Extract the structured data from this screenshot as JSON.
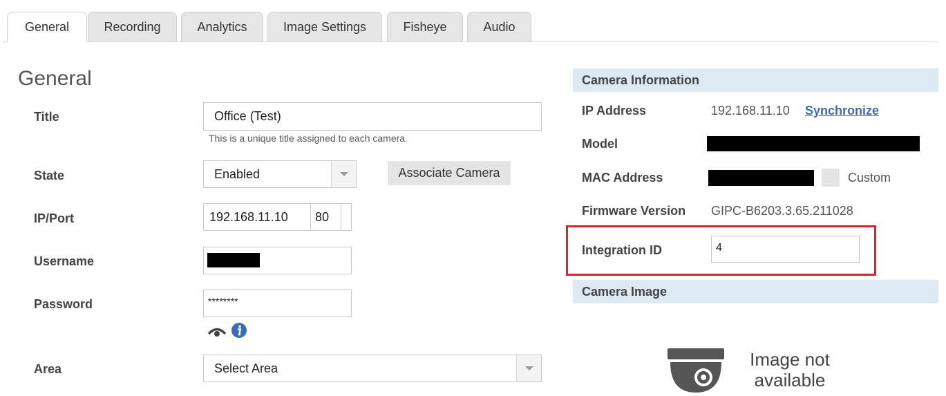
{
  "tabs": [
    {
      "label": "General",
      "active": true
    },
    {
      "label": "Recording",
      "active": false
    },
    {
      "label": "Analytics",
      "active": false
    },
    {
      "label": "Image Settings",
      "active": false
    },
    {
      "label": "Fisheye",
      "active": false
    },
    {
      "label": "Audio",
      "active": false
    }
  ],
  "general": {
    "heading": "General",
    "title_label": "Title",
    "title_value": "Office (Test)",
    "title_help": "This is a unique title assigned to each camera",
    "state_label": "State",
    "state_value": "Enabled",
    "associate_button": "Associate Camera",
    "ipport_label": "IP/Port",
    "ip_value": "192.168.11.10",
    "port_value": "80",
    "username_label": "Username",
    "password_label": "Password",
    "password_value": "********",
    "area_label": "Area",
    "area_value": "Select Area"
  },
  "camera_info": {
    "heading": "Camera Information",
    "ip_label": "IP Address",
    "ip_value": "192.168.11.10",
    "sync_link": "Synchronize",
    "model_label": "Model",
    "mac_label": "MAC Address",
    "custom_label": "Custom",
    "firmware_label": "Firmware Version",
    "firmware_value": "GIPC-B6203.3.65.211028",
    "integration_label": "Integration ID",
    "integration_value": "4"
  },
  "camera_image": {
    "heading": "Camera Image",
    "no_image_line1": "Image not",
    "no_image_line2": "available",
    "icon": "dome-camera-icon"
  },
  "colors": {
    "panel_header": "#dde9f3",
    "link": "#3b6cb5",
    "highlight": "#d9232d",
    "info_icon": "#3b6cb5"
  }
}
